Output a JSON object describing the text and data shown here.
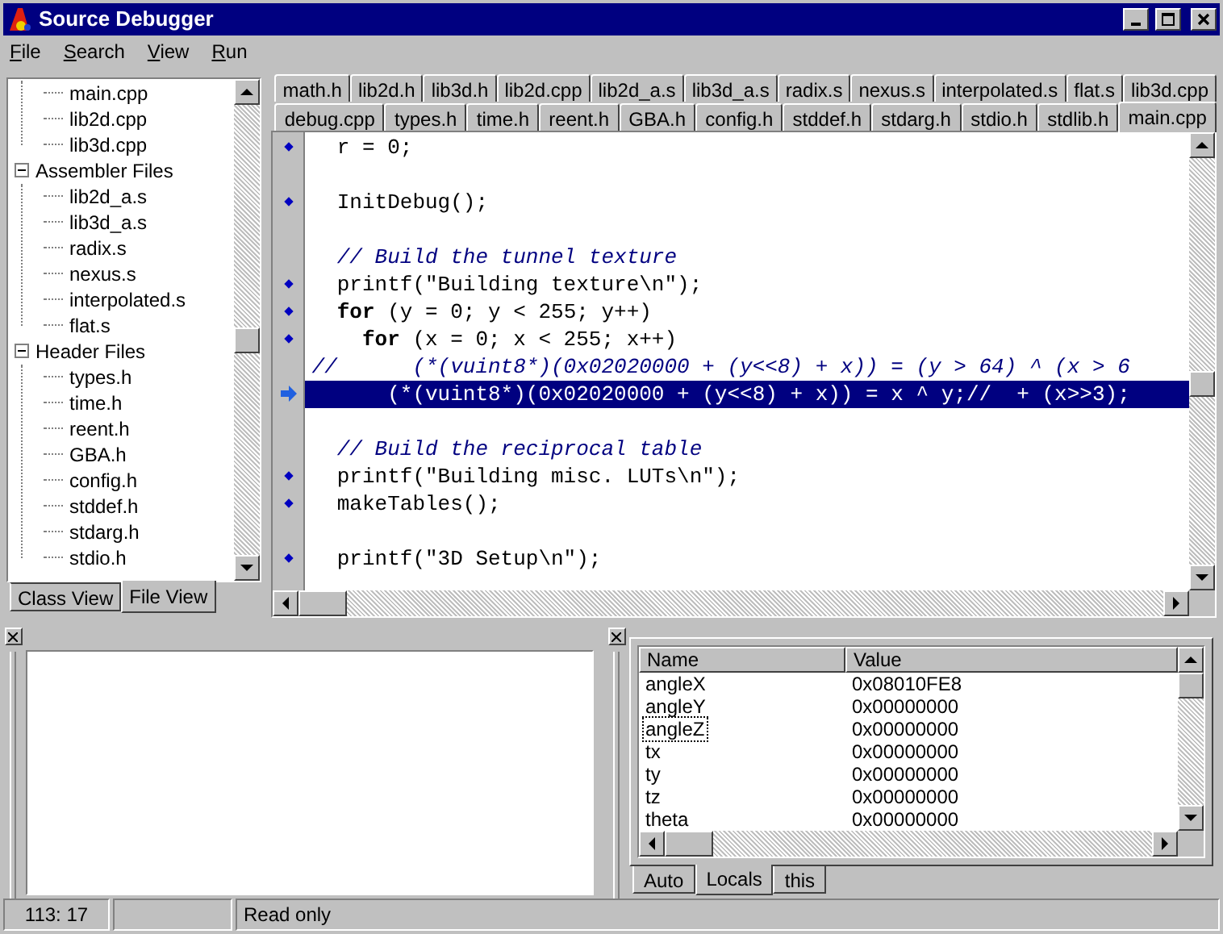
{
  "window": {
    "title": "Source Debugger"
  },
  "menu": [
    "File",
    "Search",
    "View",
    "Run"
  ],
  "tree": [
    {
      "children": [
        {
          "label": "main.cpp"
        },
        {
          "label": "lib2d.cpp"
        },
        {
          "label": "lib3d.cpp"
        }
      ]
    },
    {
      "label": "Assembler Files",
      "expanded": true,
      "children": [
        {
          "label": "lib2d_a.s"
        },
        {
          "label": "lib3d_a.s"
        },
        {
          "label": "radix.s"
        },
        {
          "label": "nexus.s"
        },
        {
          "label": "interpolated.s"
        },
        {
          "label": "flat.s"
        }
      ]
    },
    {
      "label": "Header Files",
      "expanded": true,
      "children": [
        {
          "label": "types.h"
        },
        {
          "label": "time.h"
        },
        {
          "label": "reent.h"
        },
        {
          "label": "GBA.h"
        },
        {
          "label": "config.h"
        },
        {
          "label": "stddef.h"
        },
        {
          "label": "stdarg.h"
        },
        {
          "label": "stdio.h"
        }
      ]
    }
  ],
  "left_tabs": [
    {
      "label": "Class View",
      "selected": false
    },
    {
      "label": "File View",
      "selected": true
    }
  ],
  "tab_rows": [
    [
      {
        "label": "math.h",
        "selected": false
      },
      {
        "label": "lib2d.h",
        "selected": false
      },
      {
        "label": "lib3d.h",
        "selected": false
      },
      {
        "label": "lib2d.cpp",
        "selected": false
      },
      {
        "label": "lib2d_a.s",
        "selected": false
      },
      {
        "label": "lib3d_a.s",
        "selected": false
      },
      {
        "label": "radix.s",
        "selected": false
      },
      {
        "label": "nexus.s",
        "selected": false
      },
      {
        "label": "interpolated.s",
        "selected": false
      },
      {
        "label": "flat.s",
        "selected": false
      },
      {
        "label": "lib3d.cpp",
        "selected": false
      }
    ],
    [
      {
        "label": "debug.cpp",
        "selected": false
      },
      {
        "label": "types.h",
        "selected": false
      },
      {
        "label": "time.h",
        "selected": false
      },
      {
        "label": "reent.h",
        "selected": false
      },
      {
        "label": "GBA.h",
        "selected": false
      },
      {
        "label": "config.h",
        "selected": false
      },
      {
        "label": "stddef.h",
        "selected": false
      },
      {
        "label": "stdarg.h",
        "selected": false
      },
      {
        "label": "stdio.h",
        "selected": false
      },
      {
        "label": "stdlib.h",
        "selected": false
      },
      {
        "label": "main.cpp",
        "selected": true
      }
    ]
  ],
  "code": [
    {
      "kind": "code",
      "parts": [
        {
          "text": "  r = 0;"
        }
      ],
      "breakpoint": true,
      "current": false
    },
    {
      "kind": "blank"
    },
    {
      "kind": "code",
      "parts": [
        {
          "text": "  InitDebug();"
        }
      ],
      "breakpoint": true,
      "current": false
    },
    {
      "kind": "blank"
    },
    {
      "kind": "comment",
      "parts": [
        {
          "text": "  // Build the tunnel texture"
        }
      ],
      "breakpoint": false,
      "current": false
    },
    {
      "kind": "code",
      "parts": [
        {
          "text": "  printf(\"Building texture\\n\");"
        }
      ],
      "breakpoint": true,
      "current": false
    },
    {
      "kind": "code",
      "parts": [
        {
          "text": "  for",
          "keyword": true
        },
        {
          "text": " (y = 0; y < 255; y++)",
          "keyword": false
        }
      ],
      "breakpoint": true,
      "current": false
    },
    {
      "kind": "code",
      "parts": [
        {
          "text": "    for",
          "keyword": true
        },
        {
          "text": " (x = 0; x < 255; x++)",
          "keyword": false
        }
      ],
      "breakpoint": true,
      "current": false
    },
    {
      "kind": "comment",
      "parts": [
        {
          "text": "//      (*(vuint8*)(0x02020000 + (y<<8) + x)) = (y > 64) ^ (x > 6"
        }
      ],
      "breakpoint": false,
      "current": false
    },
    {
      "kind": "code",
      "parts": [
        {
          "text": "      (*(vuint8*)(0x02020000 + (y<<8) + x)) = x ^ y;//  + (x>>3);"
        }
      ],
      "breakpoint": false,
      "current": true
    },
    {
      "kind": "blank"
    },
    {
      "kind": "comment",
      "parts": [
        {
          "text": "  // Build the reciprocal table"
        }
      ],
      "breakpoint": false,
      "current": false
    },
    {
      "kind": "code",
      "parts": [
        {
          "text": "  printf(\"Building misc. LUTs\\n\");"
        }
      ],
      "breakpoint": true,
      "current": false
    },
    {
      "kind": "code",
      "parts": [
        {
          "text": "  makeTables();"
        }
      ],
      "breakpoint": true,
      "current": false
    },
    {
      "kind": "blank"
    },
    {
      "kind": "code",
      "parts": [
        {
          "text": "  printf(\"3D Setup\\n\");"
        }
      ],
      "breakpoint": true,
      "current": false
    }
  ],
  "locals": {
    "columns": [
      "Name",
      "Value"
    ],
    "rows": [
      {
        "name": "angleX",
        "value": "0x08010FE8",
        "focused": false
      },
      {
        "name": "angleY",
        "value": "0x00000000",
        "focused": false
      },
      {
        "name": "angleZ",
        "value": "0x00000000",
        "focused": true
      },
      {
        "name": "tx",
        "value": "0x00000000",
        "focused": false
      },
      {
        "name": "ty",
        "value": "0x00000000",
        "focused": false
      },
      {
        "name": "tz",
        "value": "0x00000000",
        "focused": false
      },
      {
        "name": "theta",
        "value": "0x00000000",
        "focused": false
      }
    ],
    "tabs": [
      {
        "label": "Auto",
        "selected": false
      },
      {
        "label": "Locals",
        "selected": true
      },
      {
        "label": "this",
        "selected": false
      }
    ]
  },
  "status_bar": {
    "position": "113: 17",
    "mode": "Read only"
  }
}
